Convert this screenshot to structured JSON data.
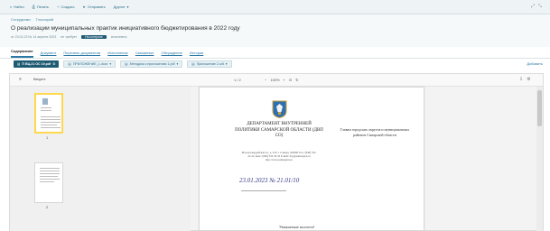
{
  "toolbar": {
    "items": [
      "Найти",
      "Печать",
      "Создать",
      "Отправить",
      "Другое"
    ],
    "right": [
      "⤢",
      "⤡"
    ]
  },
  "breadcrumbs": [
    "Сотрудники",
    "Глоссарий"
  ],
  "title": "О реализации муниципальных практик инициативного бюджетирования в 2022 году",
  "meta": {
    "number": "от 23.02.23 № 14 апреля 2023",
    "status": "На контроле",
    "note": "не требует",
    "extra": "исполнено"
  },
  "tabs": [
    "Содержание",
    "Документ",
    "Перечень документов",
    "Исполнение",
    "Связанные",
    "Обсуждение",
    "История"
  ],
  "files": {
    "active": "П ВЦ.21 ОС 19.pdf",
    "items": [
      "ПРИЛОЖЕНИЕ_1.docx",
      "Методика к приложению 1.pdf",
      "Приложение 2.odt"
    ],
    "right": "Добавить"
  },
  "viewer": {
    "search": "Введите",
    "pager": "1 / 2",
    "zoom": "100%",
    "page_numbers": [
      "1",
      "2"
    ]
  },
  "document": {
    "department": "ДЕПАРТАМЕНТ ВНУТРЕННЕЙ ПОЛИТИКИ САМАРСКОЙ ОБЛАСТИ (ДВП СО)",
    "address": "Молодогвардейская ул., д. 210, г. Самара, 443006 Тел.: (846) 332-22-22, факс: (846) 333-33-33 E-mail: dvp@samregion.ru http://www.samregion.ru",
    "handwriting": "23.01.2023  № 21.01/10",
    "recipient": "Главам городских округов и муниципальных районов Самарской области",
    "greeting": "Уважаемые коллеги!"
  }
}
